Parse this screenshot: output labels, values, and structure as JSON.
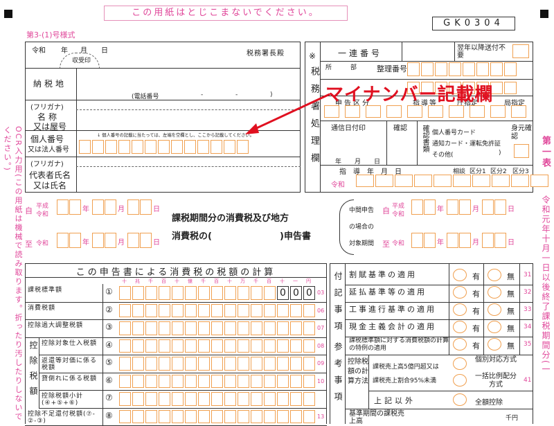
{
  "header": {
    "notice": "この用紙はとじこまないでください。",
    "code": "GK0304",
    "form_number": "第3-(1)号様式"
  },
  "left_top": {
    "era": "令和",
    "year": "年",
    "month": "月",
    "day": "日",
    "tax_office": "税務署長殿",
    "receipt_stamp": "収受印",
    "address_label": "納税地",
    "phone_label": "(電話番号",
    "phone_sep1": "-",
    "phone_sep2": "-",
    "phone_end": ")",
    "furigana1": "(フリガナ)",
    "name_label_1": "名称",
    "name_label_2": "又は屋号",
    "individual_label_1": "個人番号",
    "individual_label_2": "又は法人番号",
    "individual_note": "↓ 個人番号の記載に当たっては、左端を空欄とし、ここから記載してください。",
    "furigana2": "(フリガナ)",
    "rep_label_1": "代表者氏名",
    "rep_label_2": "又は氏名"
  },
  "annotation": {
    "text": "マイナンバー記載欄"
  },
  "office": {
    "mark": "※",
    "vertical_label": "税務署処理欄",
    "serial": "一連番号",
    "next_year": "翌年以降送付不要",
    "ledger": "整理番号",
    "office_col": "所",
    "dept_col": "部",
    "report_type": "申告区分",
    "guidance": "指導等",
    "office_designation": "庁指定",
    "local_designation": "局指定",
    "comm_date": "通信日付印",
    "confirm": "確認",
    "doc_check": "確認書類",
    "mynumber_card": "個人番号カード",
    "notice_card": "通知カード・運転免許証",
    "other": "その他(",
    "other_end": ")",
    "id_check": "身元確認",
    "year": "年",
    "month": "月",
    "day": "日",
    "guidance_row": "指導年月日",
    "era": "令和",
    "consult": "相談",
    "cat1": "区分1",
    "cat2": "区分2",
    "cat3": "区分3"
  },
  "period": {
    "from": "自",
    "to": "至",
    "heisei": "平成",
    "reiwa": "令和",
    "year": "年",
    "month": "月",
    "day": "日",
    "title_1": "課税期間分の消費税及び地方",
    "title_2": "消費税の(",
    "title_3": ")申告書",
    "mid_1": "中間申告",
    "mid_2": "の場合の",
    "mid_3": "対象期間",
    "side_table": "第一表",
    "side_date": "令和元年十月一日以後終了課税期間分(一"
  },
  "left_side_text": "OCR入力用(この用紙は機械で読み取ります。折ったり汚したりしないでください。)",
  "calc": {
    "title": "この申告書による消費税の税額の計算",
    "digits": [
      "十",
      "兆",
      "千",
      "百",
      "十",
      "億",
      "千",
      "百",
      "十",
      "万",
      "千",
      "百",
      "十",
      "一",
      "円"
    ],
    "zeros": [
      "0",
      "0",
      "0"
    ],
    "rows": [
      {
        "label": "課税標準額",
        "num": "①",
        "code": "03"
      },
      {
        "label": "消費税額",
        "num": "②",
        "code": "06"
      },
      {
        "label": "控除過大調整税額",
        "num": "③",
        "code": "07"
      },
      {
        "label": "控除対象仕入税額",
        "num": "④",
        "code": "08"
      },
      {
        "label": "返還等対価に係る税額",
        "num": "⑤",
        "code": "09"
      },
      {
        "label": "貸倒れに係る税額",
        "num": "⑥",
        "code": "10"
      },
      {
        "label": "控除税額小計(④+⑤+⑥)",
        "num": "⑦",
        "code": ""
      },
      {
        "label": "控除不足還付税額(⑦-②-③)",
        "num": "⑧",
        "code": "13"
      }
    ],
    "group_label": "控除税額"
  },
  "notes": {
    "col1": "付記事項",
    "col2": "参考事項",
    "yes": "有",
    "no": "無",
    "rows": [
      {
        "label": "割賦基準の適用",
        "code": "31"
      },
      {
        "label": "延払基準等の適用",
        "code": "32"
      },
      {
        "label": "工事進行基準の適用",
        "code": "33"
      },
      {
        "label": "現金主義会計の適用",
        "code": "34"
      },
      {
        "label": "課税標準額に対する消費税額の計算の特例の適用",
        "code": "35"
      }
    ],
    "method_label": "控除税額の計算方法",
    "method_a": "課税売上高5億円超又は",
    "method_b": "課税売上割合95%未満",
    "method_c": "個別対応方式",
    "method_d": "一括比例配分方式",
    "method_code": "41",
    "other_label": "上記以外",
    "full_deduction": "全額控除",
    "base_label": "基準期間の課税売上高",
    "thousand_yen": "千円"
  }
}
